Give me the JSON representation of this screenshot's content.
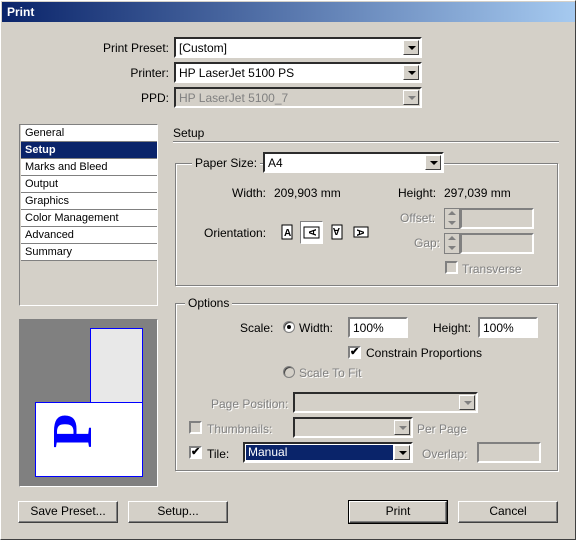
{
  "window": {
    "title": "Print"
  },
  "top": {
    "print_preset_label": "Print Preset:",
    "print_preset_value": "[Custom]",
    "printer_label": "Printer:",
    "printer_value": "HP LaserJet 5100 PS",
    "ppd_label": "PPD:",
    "ppd_value": "HP LaserJet 5100_7"
  },
  "sidebar": {
    "items": [
      {
        "label": "General"
      },
      {
        "label": "Setup"
      },
      {
        "label": "Marks and Bleed"
      },
      {
        "label": "Output"
      },
      {
        "label": "Graphics"
      },
      {
        "label": "Color Management"
      },
      {
        "label": "Advanced"
      },
      {
        "label": "Summary"
      }
    ],
    "selected": "Setup"
  },
  "setup": {
    "section_title": "Setup",
    "paper_size_label": "Paper Size:",
    "paper_size_value": "A4",
    "width_label": "Width:",
    "width_value": "209,903 mm",
    "height_label": "Height:",
    "height_value": "297,039 mm",
    "orientation_label": "Orientation:",
    "offset_label": "Offset:",
    "gap_label": "Gap:",
    "transverse_label": "Transverse"
  },
  "options": {
    "group_title": "Options",
    "scale_label": "Scale:",
    "scale_width_label": "Width:",
    "scale_width_value": "100%",
    "scale_height_label": "Height:",
    "scale_height_value": "100%",
    "constrain_label": "Constrain Proportions",
    "scale_to_fit_label": "Scale To Fit",
    "page_position_label": "Page Position:",
    "thumbnails_label": "Thumbnails:",
    "per_page_label": "Per Page",
    "tile_label": "Tile:",
    "tile_value": "Manual",
    "overlap_label": "Overlap:"
  },
  "preview": {
    "glyph": "P"
  },
  "buttons": {
    "save_preset": "Save Preset...",
    "setup": "Setup...",
    "print": "Print",
    "cancel": "Cancel"
  },
  "colors": {
    "selection": "#0a246a",
    "dialog_bg": "#d4d0c8",
    "preview_accent": "#0000ff"
  }
}
